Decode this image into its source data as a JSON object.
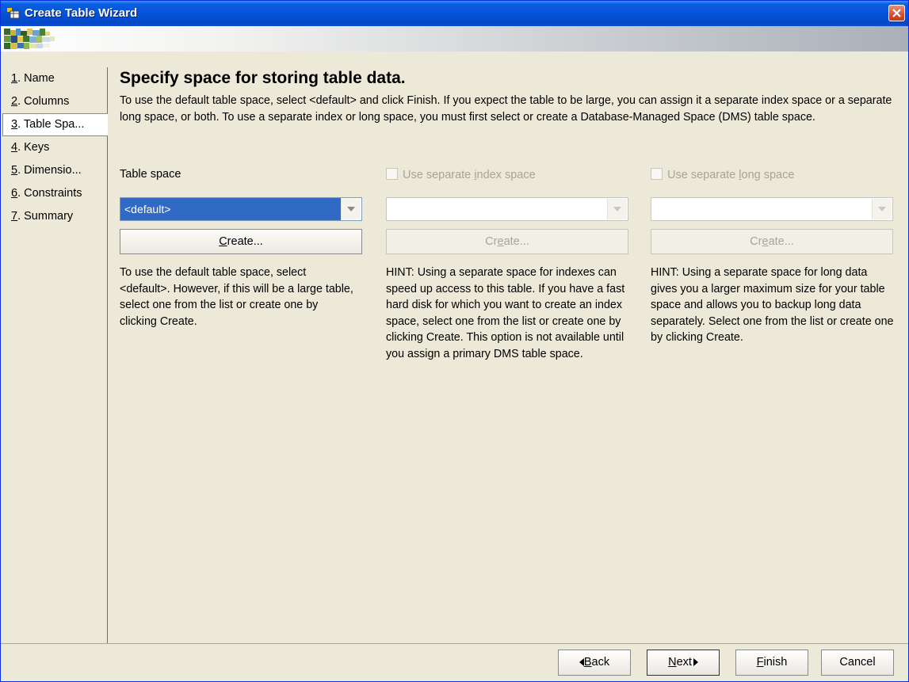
{
  "window": {
    "title": "Create Table Wizard"
  },
  "nav": [
    {
      "num": "1",
      "label": ". Name"
    },
    {
      "num": "2",
      "label": ". Columns"
    },
    {
      "num": "3",
      "label": ". Table Spa..."
    },
    {
      "num": "4",
      "label": ". Keys"
    },
    {
      "num": "5",
      "label": ". Dimensio..."
    },
    {
      "num": "6",
      "label": ". Constraints"
    },
    {
      "num": "7",
      "label": ". Summary"
    }
  ],
  "page": {
    "heading": "Specify space for storing table data.",
    "description": "To use the default table space, select <default> and click Finish. If you expect the table to be large, you can assign it a separate index space or a separate long space, or both. To use a separate index or long space, you must first select or create a Database-Managed Space (DMS) table space."
  },
  "table_space": {
    "label": "Table space",
    "value": "<default>",
    "create_mnemonic": "C",
    "create_rest": "reate...",
    "hint": "To use the default table space, select <default>. However, if this will be a large table, select one from the list or create one by clicking Create."
  },
  "index_space": {
    "checkbox_pre": "Use separate ",
    "checkbox_mnemonic": "i",
    "checkbox_post": "ndex space",
    "value": "",
    "create_pre": "Cr",
    "create_mnemonic": "e",
    "create_post": "ate...",
    "hint": "HINT: Using a separate space for indexes can speed up access to this table. If you have a fast hard disk for which you want to create an index space, select one from the list or create one by clicking Create. This option is not available until you assign a primary DMS table space."
  },
  "long_space": {
    "checkbox_pre": "Use separate ",
    "checkbox_mnemonic": "l",
    "checkbox_post": "ong space",
    "value": "",
    "create_pre": "Cr",
    "create_mnemonic": "e",
    "create_post": "ate...",
    "hint": "HINT: Using a separate space for long data gives you a larger maximum size for your table space and allows you to backup long data separately. Select one from the list or create one by clicking Create."
  },
  "footer": {
    "back_mnemonic": "B",
    "back_rest": "ack",
    "next_mnemonic": "N",
    "next_rest": "ext",
    "finish_mnemonic": "F",
    "finish_rest": "inish",
    "cancel": "Cancel"
  }
}
